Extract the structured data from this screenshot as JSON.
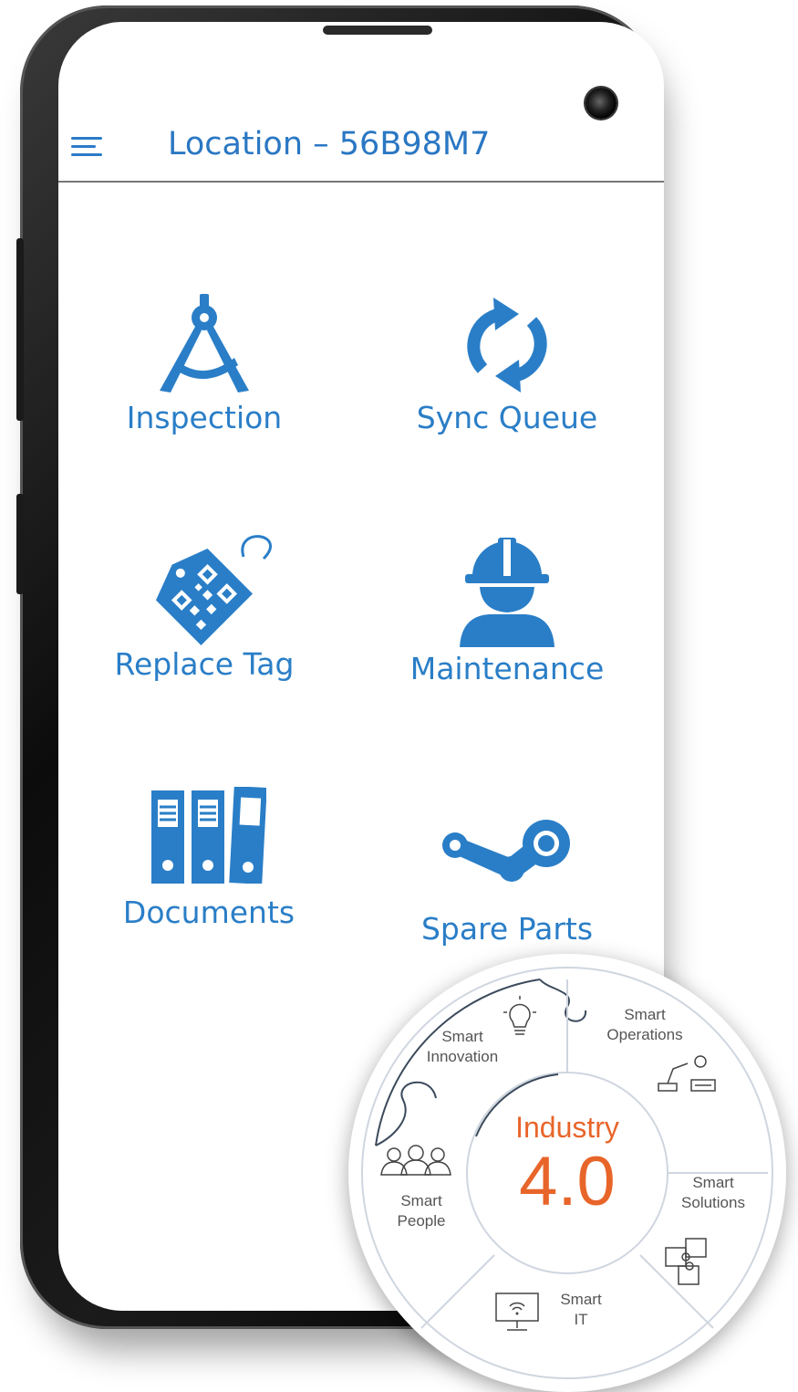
{
  "header": {
    "title": "Location – 56B98M7",
    "menu_icon": "hamburger-menu-icon"
  },
  "tiles": [
    {
      "label": "Inspection",
      "icon": "compass-icon"
    },
    {
      "label": "Sync Queue",
      "icon": "sync-icon"
    },
    {
      "label": "Replace Tag",
      "icon": "qr-tag-icon"
    },
    {
      "label": "Maintenance",
      "icon": "worker-hardhat-icon"
    },
    {
      "label": "Documents",
      "icon": "binders-icon"
    },
    {
      "label": "Spare Parts",
      "icon": "linkage-icon"
    }
  ],
  "badge": {
    "industry_label": "Industry",
    "version": "4.0",
    "segments": [
      {
        "line1": "Smart",
        "line2": "Innovation",
        "icon": "lightbulb-icon"
      },
      {
        "line1": "Smart",
        "line2": "Operations",
        "icon": "robot-arm-icon"
      },
      {
        "line1": "Smart",
        "line2": "Solutions",
        "icon": "puzzle-icon"
      },
      {
        "line1": "Smart",
        "line2": "IT",
        "icon": "wifi-monitor-icon"
      },
      {
        "line1": "Smart",
        "line2": "People",
        "icon": "people-icon"
      }
    ]
  },
  "colors": {
    "accent": "#2a7ec7",
    "badge_accent": "#e8652a"
  }
}
